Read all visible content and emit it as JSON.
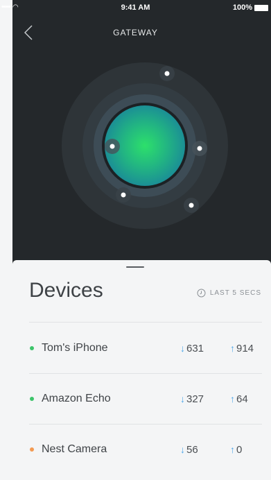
{
  "status_bar": {
    "signal": "•••••",
    "time": "9:41 AM",
    "battery": "100%"
  },
  "nav": {
    "title": "GATEWAY"
  },
  "devices_panel": {
    "title": "Devices",
    "refresh_label": "LAST 5 SECS",
    "arrow_down": "↓",
    "arrow_up": "↑",
    "devices": [
      {
        "name": "Tom's iPhone",
        "down": "631",
        "up": "914",
        "status_color": "#3dc46a"
      },
      {
        "name": "Amazon Echo",
        "down": "327",
        "up": "64",
        "status_color": "#3dc46a"
      },
      {
        "name": "Nest Camera",
        "down": "56",
        "up": "0",
        "status_color": "#f39a52"
      }
    ]
  },
  "colors": {
    "background_dark": "#24282b",
    "accent_blue": "#4da6e8",
    "gateway_green": "#2fd67a",
    "gateway_teal": "#1fa38f"
  },
  "icons": {
    "back": "chevron-left-icon",
    "refresh": "clock-icon"
  }
}
